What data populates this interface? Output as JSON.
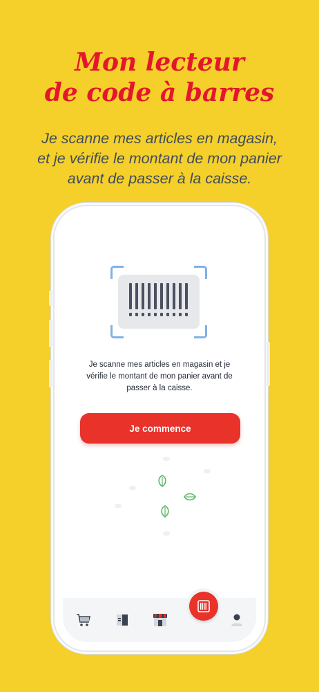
{
  "headline": {
    "line1": "Mon lecteur",
    "line2": "de code à barres"
  },
  "subline": {
    "line1": "Je scanne mes articles en magasin,",
    "line2": "et je vérifie le montant de mon panier",
    "line3": "avant de passer à la caisse."
  },
  "screen": {
    "intro": {
      "line1": "Je scanne mes articles en magasin et je",
      "line2": "vérifie le montant de mon panier avant de",
      "line3": "passer à la caisse."
    },
    "start_button_label": "Je commence"
  },
  "tabbar": {
    "tabs": [
      {
        "icon": "cart-icon"
      },
      {
        "icon": "catalog-icon"
      },
      {
        "icon": "store-icon"
      },
      {
        "icon": "barcode-scan-icon",
        "active": true
      },
      {
        "icon": "account-icon"
      }
    ]
  },
  "colors": {
    "background": "#f5cf2a",
    "headline": "#e3172c",
    "subline": "#3f4c5e",
    "accent": "#e8322a",
    "scan_corners": "#7fb1e6",
    "leaf": "#5cb86a"
  }
}
